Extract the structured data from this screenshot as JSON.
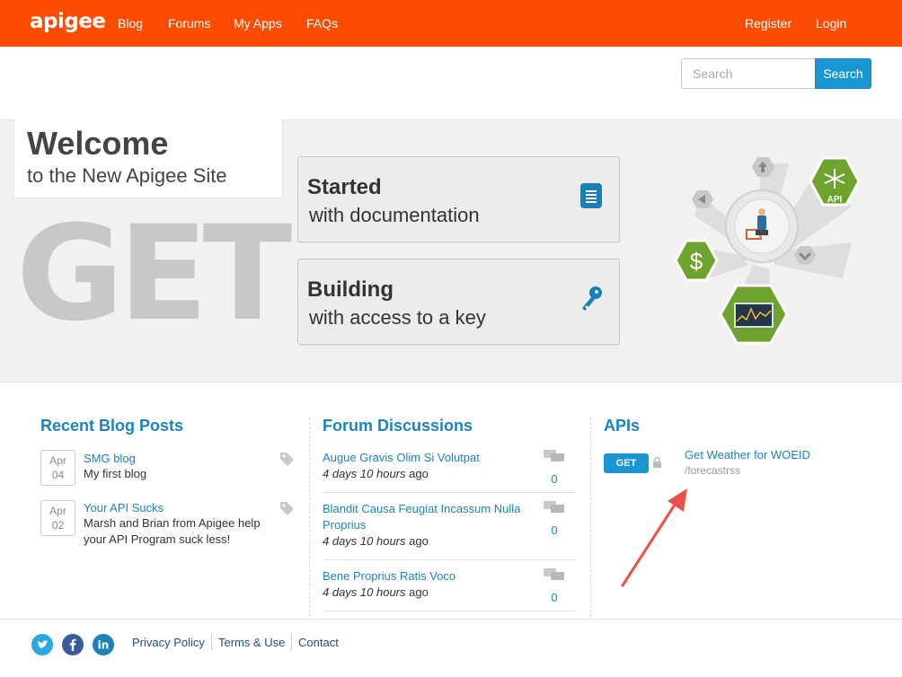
{
  "brand": {
    "logo": "apigee",
    "accent": "#fc4c02",
    "link_color": "#1d82c0",
    "button_color": "#1a96d4"
  },
  "nav": {
    "items": [
      "Blog",
      "Forums",
      "My Apps",
      "FAQs"
    ],
    "register": "Register",
    "login": "Login"
  },
  "search": {
    "placeholder": "Search",
    "button": "Search"
  },
  "hero": {
    "welcome_title": "Welcome",
    "welcome_subtitle": "to the New Apigee Site",
    "big_word": "GET",
    "cards": [
      {
        "title": "Started",
        "subtitle": "with documentation",
        "icon": "document-icon"
      },
      {
        "title": "Building",
        "subtitle": "with access to a key",
        "icon": "key-icon"
      }
    ],
    "diagram_label": "API"
  },
  "blog": {
    "heading": "Recent Blog Posts",
    "posts": [
      {
        "month": "Apr",
        "day": "04",
        "title": "SMG blog",
        "body": "My first blog"
      },
      {
        "month": "Apr",
        "day": "02",
        "title": "Your API Sucks",
        "body": "Marsh and Brian from Apigee help your API Program suck less!"
      }
    ]
  },
  "forum": {
    "heading": "Forum Discussions",
    "topics": [
      {
        "title": "Augue Gravis Olim Si Volutpat",
        "age": "4 days 10 hours",
        "suffix": "ago",
        "comments": "0"
      },
      {
        "title": "Blandit Causa Feugiat Incassum Nulla Proprius",
        "age": "4 days 10 hours",
        "suffix": "ago",
        "comments": "0"
      },
      {
        "title": "Bene Proprius Ratis Voco",
        "age": "4 days 10 hours",
        "suffix": "ago",
        "comments": "0"
      }
    ]
  },
  "apis": {
    "heading": "APIs",
    "items": [
      {
        "method": "GET",
        "title": "Get Weather for WOEID",
        "path": "/forecastrss"
      }
    ]
  },
  "footer": {
    "social": [
      "twitter-icon",
      "facebook-icon",
      "linkedin-icon"
    ],
    "links": [
      "Privacy Policy",
      "Terms & Use",
      "Contact"
    ]
  }
}
